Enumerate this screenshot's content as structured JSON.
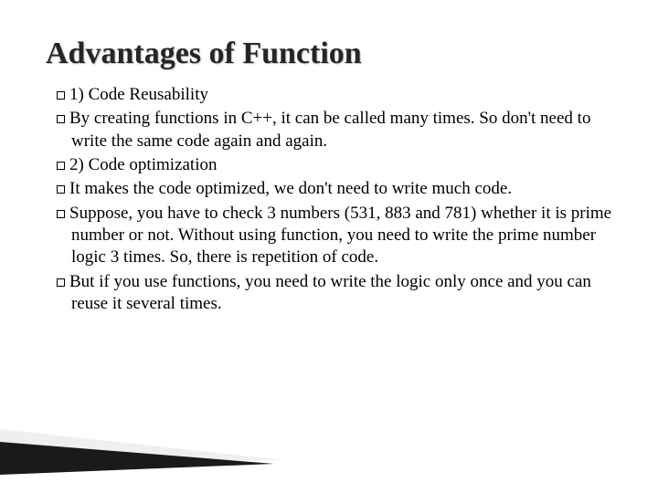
{
  "title": "Advantages of Function",
  "paragraphs": [
    "1) Code Reusability",
    "By creating functions in C++, it can be called  many times. So don't need to write the same code again and again.",
    "2) Code optimization",
    "It makes the code optimized, we don't need to write much code.",
    "Suppose, you have to check 3 numbers (531, 883 and 781) whether it is prime number or not. Without using function, you need to write the prime number logic 3 times. So, there is repetition of code.",
    "But if you use functions, you need to write the logic only once and you can reuse it several times."
  ]
}
